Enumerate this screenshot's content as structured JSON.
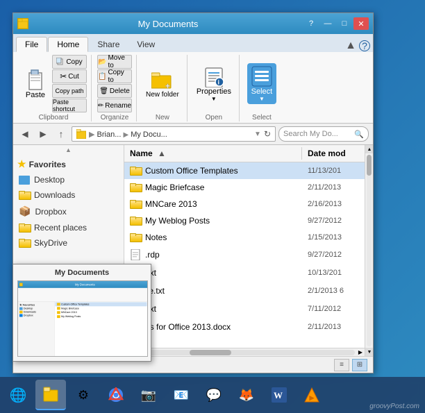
{
  "window": {
    "title": "My Documents",
    "icon": "folder"
  },
  "titlebar": {
    "minimize": "—",
    "maximize": "□",
    "close": "✕"
  },
  "ribbon": {
    "tabs": [
      "File",
      "Home",
      "Share",
      "View"
    ],
    "active_tab": "Home",
    "groups": {
      "clipboard": {
        "label": "Clipboard",
        "paste": "Paste",
        "copy": "Copy",
        "cut": "Cut",
        "copy_path": "Copy path",
        "paste_shortcut": "Paste shortcut"
      },
      "organize": {
        "label": "Organize",
        "move_to": "Move to",
        "copy_to": "Copy to",
        "delete": "Delete",
        "rename": "Rename"
      },
      "new": {
        "label": "New",
        "new_folder": "New folder"
      },
      "open": {
        "label": "Open",
        "properties": "Properties"
      },
      "select": {
        "label": "Select",
        "select_all": "Select"
      }
    }
  },
  "address_bar": {
    "breadcrumb": "Brian... › My Docu...",
    "refresh": "↻",
    "search_placeholder": "Search My Do..."
  },
  "sidebar": {
    "section": "Favorites",
    "items": [
      {
        "label": "Desktop",
        "type": "desktop"
      },
      {
        "label": "Downloads",
        "type": "folder"
      },
      {
        "label": "Dropbox",
        "type": "dropbox"
      },
      {
        "label": "Recent places",
        "type": "folder"
      },
      {
        "label": "SkyDrive",
        "type": "folder"
      }
    ]
  },
  "files": {
    "columns": [
      "Name",
      "Date mod"
    ],
    "sort_col": "Name",
    "sort_dir": "asc",
    "rows": [
      {
        "name": "Custom Office Templates",
        "date": "11/13/201",
        "type": "folder",
        "selected": true
      },
      {
        "name": "Magic Briefcase",
        "date": "2/11/2013",
        "type": "folder"
      },
      {
        "name": "MNCare 2013",
        "date": "2/16/2013",
        "type": "folder"
      },
      {
        "name": "My Weblog Posts",
        "date": "9/27/2012",
        "type": "folder"
      },
      {
        "name": "Notes",
        "date": "1/15/2013",
        "type": "folder"
      },
      {
        "name": ".rdp",
        "date": "9/27/2012",
        "type": "file"
      },
      {
        "name": ".txt",
        "date": "10/13/201",
        "type": "file"
      },
      {
        "name": "ile.txt",
        "date": "2/1/2013 6",
        "type": "file"
      },
      {
        "name": ".txt",
        "date": "7/11/2012",
        "type": "file"
      },
      {
        "name": "es for Office 2013.docx",
        "date": "2/11/2013",
        "type": "file"
      }
    ]
  },
  "thumbnail": {
    "title": "My Documents",
    "visible": true
  },
  "taskbar": {
    "items": [
      {
        "label": "IE",
        "icon": "🌐",
        "type": "browser"
      },
      {
        "label": "Explorer",
        "icon": "📁",
        "type": "explorer",
        "active": true
      },
      {
        "label": "App3",
        "icon": "⚙",
        "type": "app"
      },
      {
        "label": "Chrome",
        "icon": "🔵",
        "type": "browser"
      },
      {
        "label": "App5",
        "icon": "📷",
        "type": "app"
      },
      {
        "label": "Outlook",
        "icon": "📧",
        "type": "mail"
      },
      {
        "label": "Skype",
        "icon": "💬",
        "type": "comm"
      },
      {
        "label": "Firefox",
        "icon": "🦊",
        "type": "browser"
      },
      {
        "label": "Word",
        "icon": "📝",
        "type": "office"
      },
      {
        "label": "VLC",
        "icon": "🎵",
        "type": "media"
      }
    ],
    "watermark": "groovyPost.com"
  },
  "status_bar": {
    "info": "",
    "view_list": "≡",
    "view_details": "⊞"
  }
}
